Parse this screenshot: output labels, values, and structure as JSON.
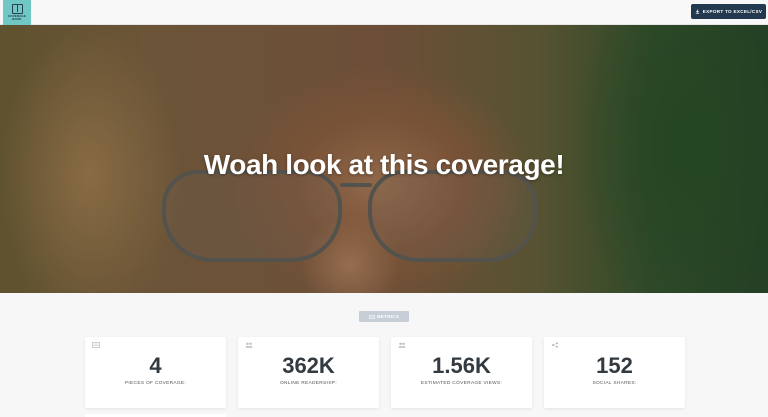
{
  "header": {
    "logo_text": [
      "COVERAGE",
      "BOOK"
    ],
    "export_label": "EXPORT TO EXCEL/CSV"
  },
  "hero": {
    "title": "Woah look at this coverage!"
  },
  "metrics": {
    "section_label": "METRICS",
    "cards": [
      {
        "value": "4",
        "label": "PIECES OF COVERAGE:",
        "icon": "list-icon"
      },
      {
        "value": "362K",
        "label": "ONLINE READERSHIP:",
        "icon": "users-icon"
      },
      {
        "value": "1.56K",
        "label": "ESTIMATED COVERAGE VIEWS:",
        "icon": "users-icon"
      },
      {
        "value": "152",
        "label": "SOCIAL SHARES:",
        "icon": "share-icon"
      }
    ]
  },
  "colors": {
    "accent": "#6fc8c4",
    "button": "#23394f",
    "pill": "#c7ced6"
  }
}
